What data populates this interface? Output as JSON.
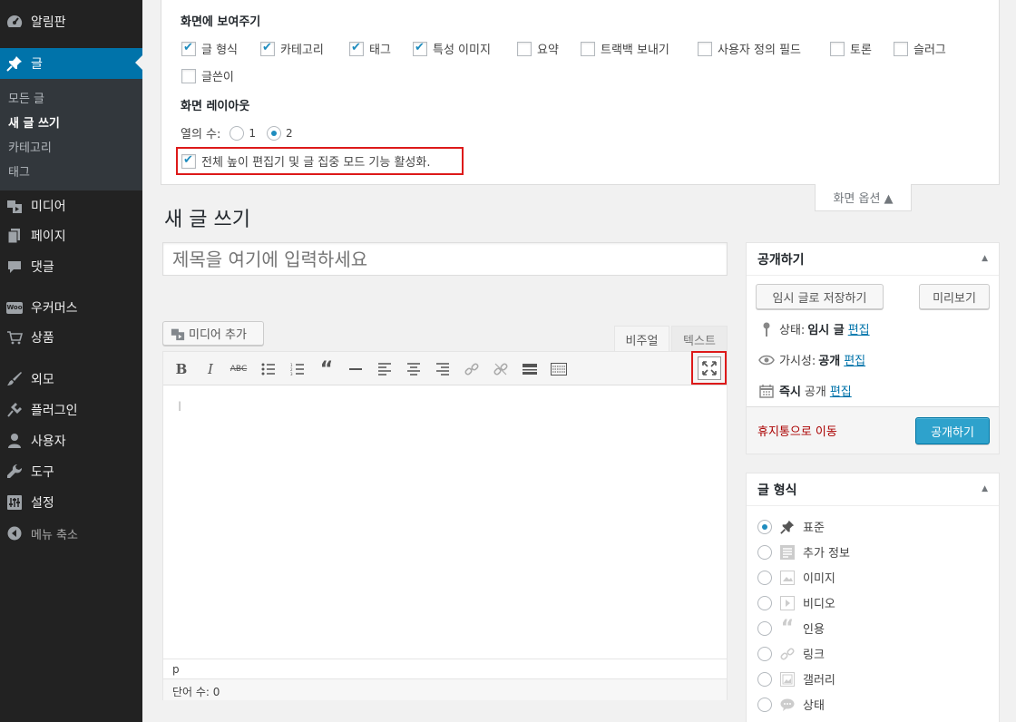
{
  "menu": {
    "dashboard": "알림판",
    "posts": "글",
    "posts_sub": [
      "모든 글",
      "새 글 쓰기",
      "카테고리",
      "태그"
    ],
    "media": "미디어",
    "pages": "페이지",
    "comments": "댓글",
    "woocommerce": "우커머스",
    "products": "상품",
    "appearance": "외모",
    "plugins": "플러그인",
    "users": "사용자",
    "tools": "도구",
    "settings": "설정",
    "collapse": "메뉴 축소",
    "woo_icon_text": "Woo"
  },
  "screen_options": {
    "show_heading": "화면에 보여주기",
    "checks": [
      {
        "label": "글 형식",
        "checked": true
      },
      {
        "label": "카테고리",
        "checked": true
      },
      {
        "label": "태그",
        "checked": true
      },
      {
        "label": "특성 이미지",
        "checked": true
      },
      {
        "label": "요약",
        "checked": false
      },
      {
        "label": "트랙백 보내기",
        "checked": false
      },
      {
        "label": "사용자 정의 필드",
        "checked": false
      },
      {
        "label": "토론",
        "checked": false
      },
      {
        "label": "슬러그",
        "checked": false
      },
      {
        "label": "글쓴이",
        "checked": false
      }
    ],
    "layout_heading": "화면 레이아웃",
    "columns_label": "열의 수:",
    "col1": "1",
    "col2": "2",
    "fullheight_label": "전체 높이 편집기 및 글 집중 모드 기능 활성화.",
    "tab_label": "화면 옵션 ▲"
  },
  "main": {
    "page_title": "새 글 쓰기",
    "title_placeholder": "제목을 여기에 입력하세요",
    "add_media": "미디어 추가",
    "tab_visual": "비주얼",
    "tab_text": "텍스트",
    "path": "p",
    "word_count": "단어 수: 0"
  },
  "publish": {
    "title": "공개하기",
    "save_draft": "임시 글로 저장하기",
    "preview": "미리보기",
    "status_label": "상태:",
    "status_value": "임시 글",
    "visibility_label": "가시성:",
    "visibility_value": "공개",
    "schedule_label": "즉시",
    "schedule_value": "공개",
    "edit": "편집",
    "trash": "휴지통으로 이동",
    "publish_btn": "공개하기"
  },
  "format": {
    "title": "글 형식",
    "options": [
      "표준",
      "추가 정보",
      "이미지",
      "비디오",
      "인용",
      "링크",
      "갤러리",
      "상태"
    ],
    "selected": "표준"
  },
  "toggle_arrow": "▲",
  "colors": {
    "accent": "#0073aa",
    "primary_button": "#2ea2cc",
    "highlight": "#dd1a1a",
    "sidebar": "#222222"
  }
}
